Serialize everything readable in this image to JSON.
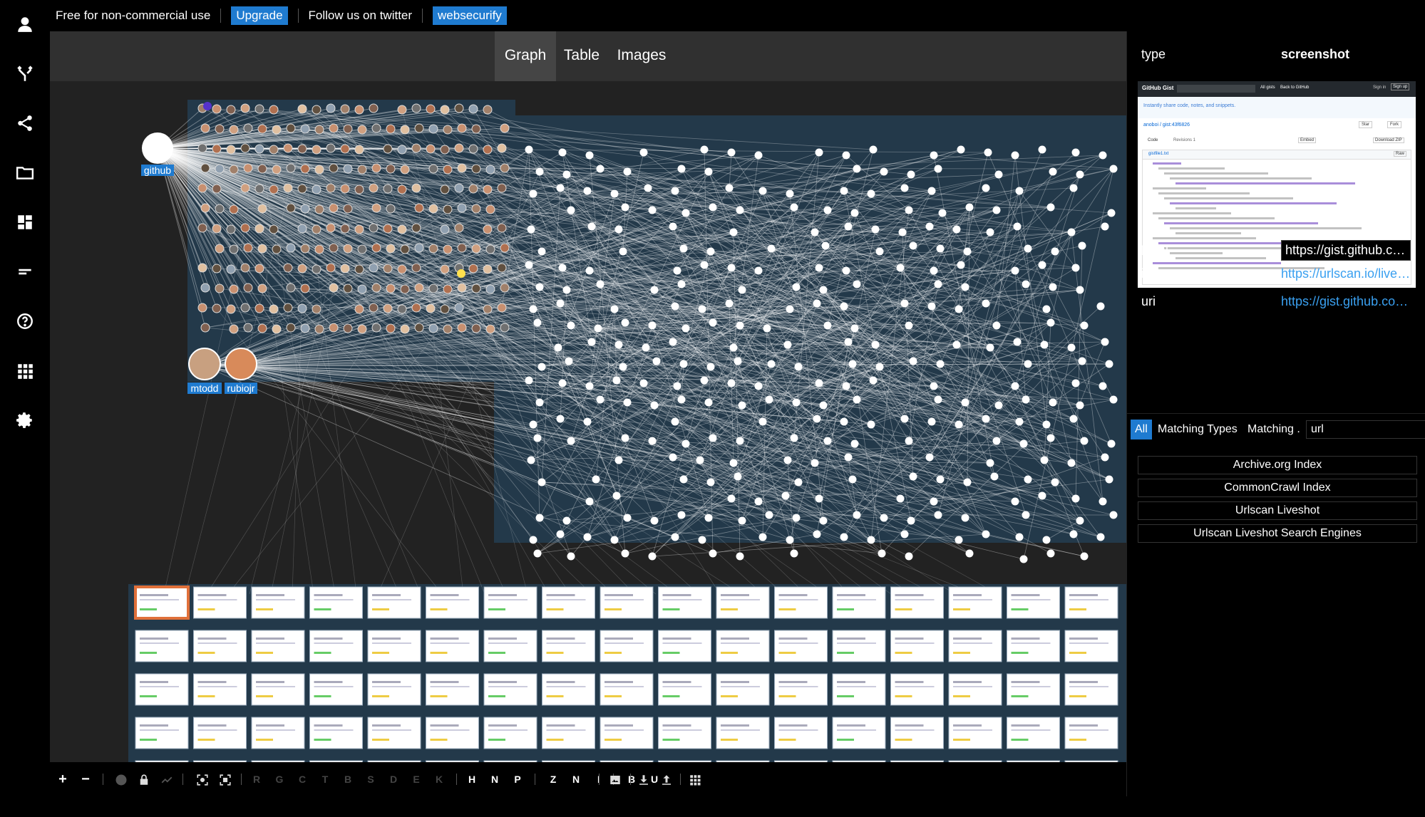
{
  "banner": {
    "free_text": "Free for non-commercial use",
    "upgrade_label": "Upgrade",
    "follow_text": "Follow us on twitter",
    "handle_label": "websecurify"
  },
  "tabs": [
    {
      "label": "Graph",
      "active": true
    },
    {
      "label": "Table",
      "active": false
    },
    {
      "label": "Images",
      "active": false
    }
  ],
  "sidebar": {
    "icons": [
      "user-icon",
      "merge-icon",
      "share-icon",
      "folder-icon",
      "dashboard-icon",
      "list-icon",
      "help-icon",
      "apps-icon",
      "settings-icon"
    ]
  },
  "graph": {
    "nodes": {
      "github": "github",
      "mtodd": "mtodd",
      "rubiojr": "rubiojr"
    },
    "colors": {
      "background": "#222222",
      "group": "#23394a",
      "edge": "#ffffff",
      "label": "#1f7bd0",
      "highlight": "#ffe14d",
      "accent": "#5533cc"
    }
  },
  "toolbar": {
    "letters": [
      {
        "t": "R",
        "on": false
      },
      {
        "t": "G",
        "on": false
      },
      {
        "t": "C",
        "on": false
      },
      {
        "t": "T",
        "on": false
      },
      {
        "t": "B",
        "on": false
      },
      {
        "t": "S",
        "on": false
      },
      {
        "t": "D",
        "on": false
      },
      {
        "t": "E",
        "on": false
      },
      {
        "t": "K",
        "on": false
      },
      {
        "t": "H",
        "on": true
      },
      {
        "t": "N",
        "on": true
      },
      {
        "t": "P",
        "on": true
      },
      {
        "t": "Z",
        "on": true
      },
      {
        "t": "N",
        "on": true
      },
      {
        "t": "I",
        "on": true
      },
      {
        "t": "B",
        "on": true
      },
      {
        "t": "U",
        "on": true
      }
    ]
  },
  "details": {
    "type_key": "type",
    "type_value": "screenshot",
    "label_key": "label",
    "label_value": "https://gist.github.co …",
    "image_key": "image",
    "image_value": "https://urlscan.io/live…",
    "uri_key": "uri",
    "uri_value": "https://gist.github.co…",
    "screenshot": {
      "logo": "GitHub Gist",
      "all_gists": "All gists",
      "back": "Back to GitHub",
      "sign_in": "Sign in",
      "sign_up": "Sign up",
      "tagline": "Instantly share code, notes, and snippets.",
      "repo": "anoboi / gist:43f6826",
      "tab_code": "Code",
      "tab_revisions": "Revisions 1",
      "star": "Star",
      "fork": "Fork",
      "embed": "Embed",
      "download": "Download ZIP",
      "file": "gistfile1.txt",
      "raw": "Raw"
    }
  },
  "filter": {
    "all": "All",
    "types": "Matching Types",
    "matching": "Matching .",
    "query": "url"
  },
  "sources": [
    "Archive.org Index",
    "CommonCrawl Index",
    "Urlscan Liveshot",
    "Urlscan Liveshot Search Engines"
  ]
}
